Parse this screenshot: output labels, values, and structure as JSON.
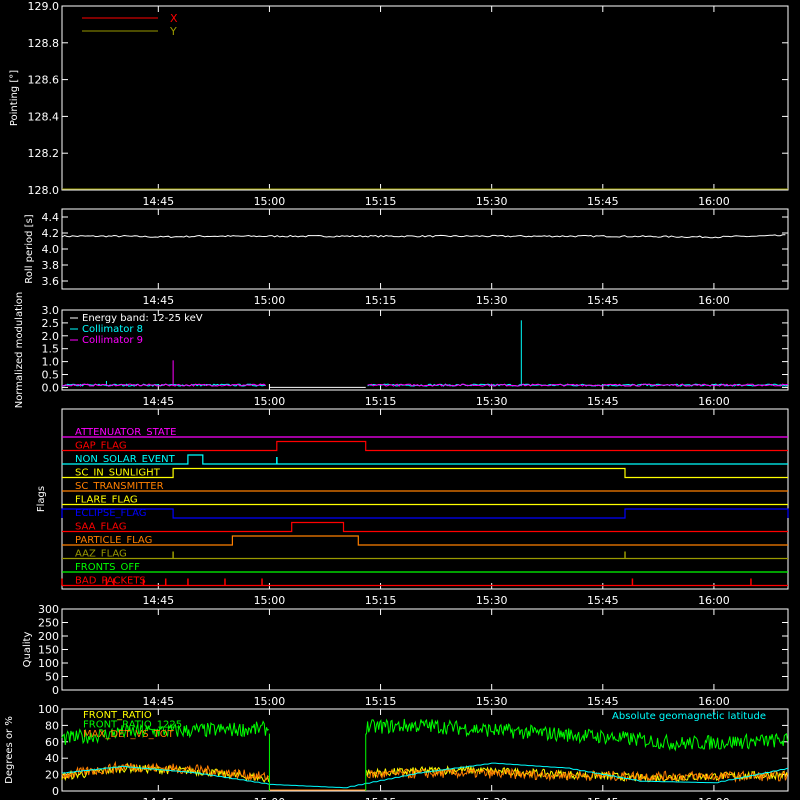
{
  "colors": {
    "background": "#000000",
    "axis": "#ffffff",
    "red": "#ff0000",
    "olive": "#999900",
    "cyan": "#00ffff",
    "magenta": "#ff00ff",
    "yellow": "#ffff00",
    "orange": "#ff7f00",
    "green": "#00ff00",
    "blue": "#0000ff",
    "lime": "#00ff33"
  },
  "time_axis": {
    "start": "14:32",
    "end": "16:10",
    "tick_labels": [
      "14:45",
      "15:00",
      "15:15",
      "15:30",
      "15:45",
      "16:00"
    ]
  },
  "chart_data": [
    {
      "id": "pointing",
      "type": "line",
      "ylabel": "Pointing [°]",
      "ylim": [
        128.0,
        129.0
      ],
      "yticks": [
        "128.0",
        "128.2",
        "128.4",
        "128.6",
        "128.8",
        "129.0"
      ],
      "legend_position": "top-left",
      "series": [
        {
          "name": "X",
          "color": "red",
          "x": [],
          "y": []
        },
        {
          "name": "Y",
          "color": "olive",
          "x": [],
          "y": []
        }
      ]
    },
    {
      "id": "roll-period",
      "type": "line",
      "ylabel": "Roll period [s]",
      "ylim": [
        3.5,
        4.5
      ],
      "yticks": [
        "3.6",
        "3.8",
        "4.0",
        "4.2",
        "4.4"
      ],
      "series": [
        {
          "name": "",
          "color": "axis",
          "x": [
            "14:32",
            "14:40",
            "14:45",
            "14:50",
            "15:00",
            "15:15",
            "15:30",
            "15:45",
            "16:00",
            "16:10"
          ],
          "y": [
            4.16,
            4.16,
            4.15,
            4.16,
            4.16,
            4.16,
            4.16,
            4.16,
            4.15,
            4.17
          ]
        }
      ]
    },
    {
      "id": "modulation",
      "type": "line",
      "ylabel": "Normalized modulation",
      "ylim": [
        -0.1,
        3.0
      ],
      "yticks": [
        "0.0",
        "0.5",
        "1.0",
        "1.5",
        "2.0",
        "2.5",
        "3.0"
      ],
      "legend_position": "top-left",
      "legend_title": "Energy band: 12-25 keV",
      "gap": [
        "15:00",
        "15:13"
      ],
      "series": [
        {
          "name": "Collimator 8",
          "color": "cyan",
          "spikes": [
            {
              "x": "14:38",
              "y": 0.25
            },
            {
              "x": "15:34",
              "y": 2.6
            }
          ]
        },
        {
          "name": "Collimator 9",
          "color": "magenta",
          "spikes": [
            {
              "x": "14:47",
              "y": 1.05
            }
          ]
        }
      ]
    },
    {
      "id": "flags",
      "type": "line",
      "ylabel": "Flags",
      "series": [
        {
          "name": "ATTENUATOR_STATE",
          "color": "magenta",
          "high": []
        },
        {
          "name": "GAP_FLAG",
          "color": "red",
          "high": [
            [
              "15:01",
              "15:13"
            ]
          ]
        },
        {
          "name": "NON_SOLAR_EVENT",
          "color": "cyan",
          "high": [
            [
              "14:49",
              "14:51"
            ]
          ],
          "ticks": [
            "15:01"
          ]
        },
        {
          "name": "SC_IN_SUNLIGHT",
          "color": "yellow",
          "high": [
            [
              "14:47",
              "15:48"
            ]
          ]
        },
        {
          "name": "SC_TRANSMITTER",
          "color": "orange",
          "high": []
        },
        {
          "name": "FLARE_FLAG",
          "color": "yellow",
          "high": []
        },
        {
          "name": "ECLIPSE_FLAG",
          "color": "blue",
          "high": [
            [
              "14:32",
              "14:47"
            ],
            [
              "15:48",
              "16:10"
            ]
          ]
        },
        {
          "name": "SAA_FLAG",
          "color": "red",
          "high": [
            [
              "15:03",
              "15:10"
            ]
          ]
        },
        {
          "name": "PARTICLE_FLAG",
          "color": "orange",
          "high": [
            [
              "14:55",
              "15:12"
            ]
          ]
        },
        {
          "name": "AAZ_FLAG",
          "color": "olive",
          "high": [],
          "ticks": [
            "14:47",
            "15:48"
          ]
        },
        {
          "name": "FRONTS_OFF",
          "color": "green",
          "high": []
        },
        {
          "name": "BAD_PACKETS",
          "color": "red",
          "high": [],
          "ticks": [
            "14:32",
            "14:38",
            "14:39",
            "14:43",
            "14:46",
            "14:49",
            "14:54",
            "14:59",
            "15:49",
            "16:05"
          ]
        }
      ]
    },
    {
      "id": "quality",
      "type": "line",
      "ylabel": "Quality",
      "ylim": [
        0,
        300
      ],
      "yticks": [
        "0",
        "50",
        "100",
        "150",
        "200",
        "250",
        "300"
      ],
      "series": []
    },
    {
      "id": "ratios",
      "type": "line",
      "ylabel": "Degrees or %",
      "ylim": [
        0,
        100
      ],
      "yticks": [
        "0",
        "20",
        "40",
        "60",
        "80",
        "100"
      ],
      "legend_position": "top-left",
      "gap": [
        "15:00",
        "15:13"
      ],
      "series": [
        {
          "name": "FRONT_RATIO",
          "color": "yellow",
          "x": [
            "14:32",
            "14:40",
            "14:50",
            "15:00",
            "15:13",
            "15:25",
            "15:35",
            "15:50",
            "16:10"
          ],
          "y": [
            18,
            28,
            24,
            14,
            22,
            26,
            22,
            16,
            20
          ]
        },
        {
          "name": "FRONT_RATIO_1225",
          "color": "green",
          "x": [
            "14:32",
            "14:40",
            "14:50",
            "15:00",
            "15:13",
            "15:20",
            "15:30",
            "15:45",
            "15:55",
            "16:10"
          ],
          "y": [
            64,
            72,
            74,
            76,
            78,
            80,
            74,
            66,
            58,
            62
          ]
        },
        {
          "name": "MAX_DET_VS_TOT",
          "color": "orange",
          "x": [
            "14:32",
            "14:40",
            "14:50",
            "15:00",
            "15:13",
            "15:25",
            "15:35",
            "15:50",
            "16:10"
          ],
          "y": [
            20,
            30,
            26,
            16,
            20,
            22,
            20,
            18,
            18
          ]
        },
        {
          "name": "Absolute geomagnetic latitude",
          "color": "cyan",
          "x": [
            "14:32",
            "14:40",
            "14:50",
            "15:00",
            "15:10",
            "15:20",
            "15:30",
            "15:40",
            "15:50",
            "16:00",
            "16:10"
          ],
          "y": [
            22,
            30,
            22,
            8,
            4,
            22,
            34,
            28,
            12,
            10,
            28
          ]
        }
      ]
    }
  ]
}
